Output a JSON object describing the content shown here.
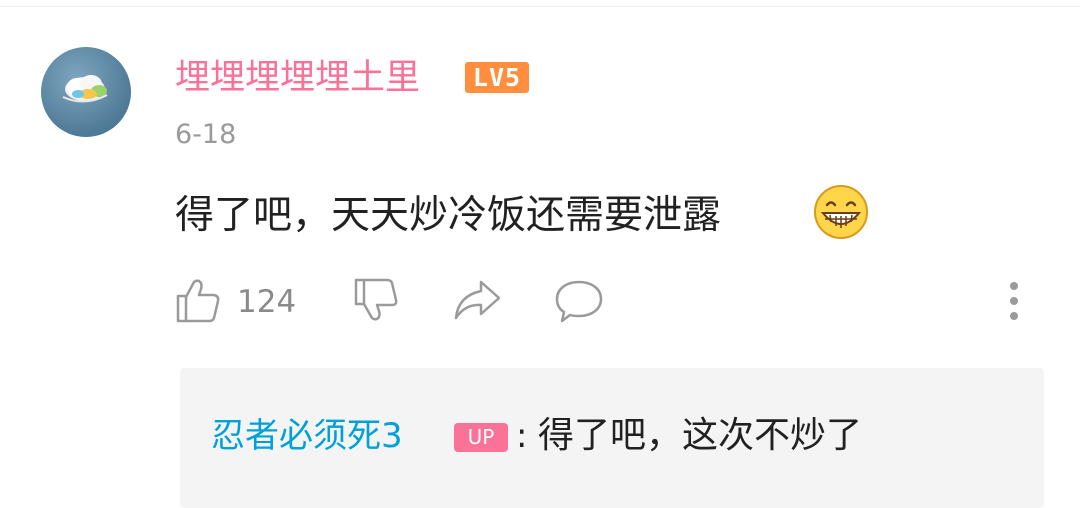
{
  "comment": {
    "username": "埋埋埋埋埋土里",
    "level_badge": "LV5",
    "date": "6-18",
    "text": "得了吧，天天炒冷饭还需要泄露",
    "emoji": "grinning-face-emoji",
    "like_count": "124"
  },
  "icons": {
    "like": "thumbs-up-icon",
    "dislike": "thumbs-down-icon",
    "share": "share-icon",
    "reply": "comment-bubble-icon",
    "more": "more-vertical-icon"
  },
  "reply": {
    "username": "忍者必须死3",
    "badge": "UP",
    "separator": ":",
    "text": "得了吧，这次不炒了"
  },
  "colors": {
    "username": "#fb7299",
    "level_badge": "#ff8f3f",
    "reply_username": "#00a1d6",
    "up_badge": "#fb7299",
    "meta_text": "#9a9a9a"
  }
}
